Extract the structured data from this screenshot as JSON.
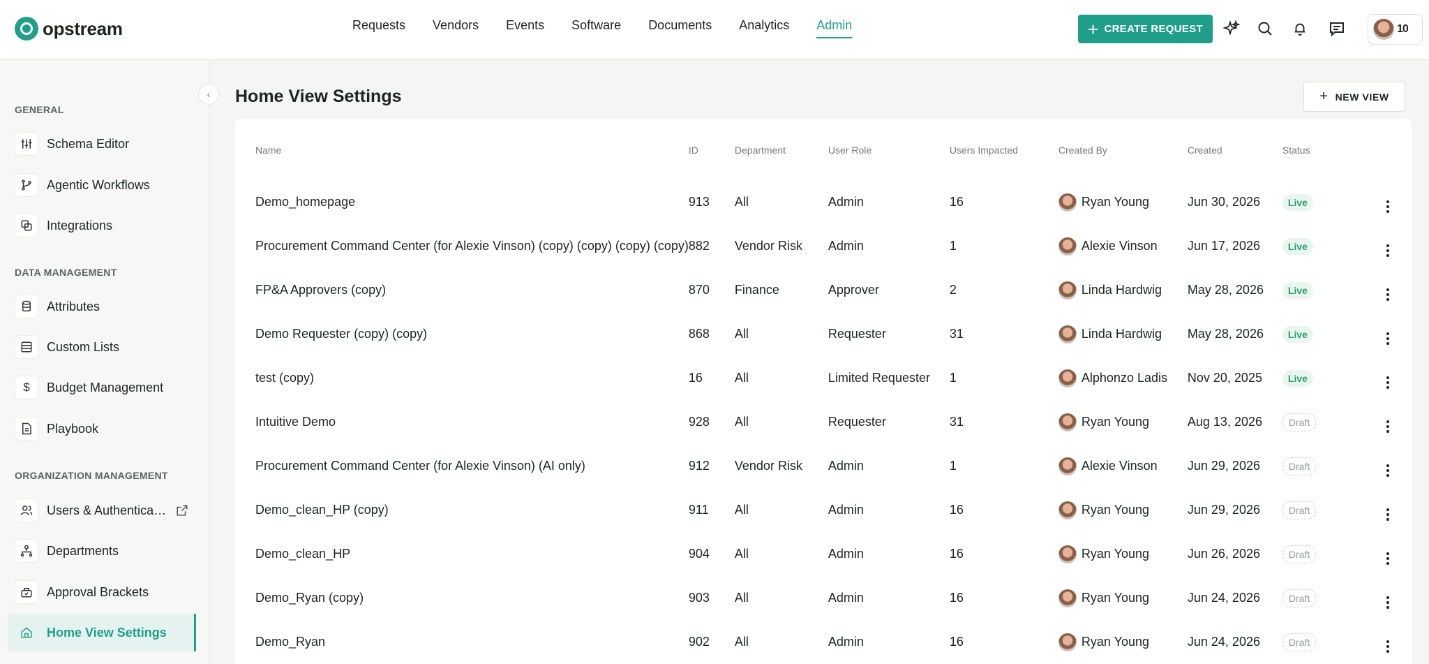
{
  "brand": {
    "name": "opstream",
    "accent": "#1f9f8a"
  },
  "nav": {
    "items": [
      "Requests",
      "Vendors",
      "Events",
      "Software",
      "Documents",
      "Analytics",
      "Admin"
    ],
    "active": "Admin",
    "create_label": "CREATE REQUEST",
    "icons": [
      "sparkle-icon",
      "search-icon",
      "bell-icon",
      "chat-icon"
    ],
    "user_initials": "10"
  },
  "sidebar": {
    "sections": [
      {
        "title": "GENERAL",
        "items": [
          {
            "label": "Schema Editor",
            "icon": "sliders-icon"
          },
          {
            "label": "Agentic Workflows",
            "icon": "branch-icon"
          },
          {
            "label": "Integrations",
            "icon": "integration-icon"
          }
        ]
      },
      {
        "title": "DATA MANAGEMENT",
        "items": [
          {
            "label": "Attributes",
            "icon": "database-icon"
          },
          {
            "label": "Custom Lists",
            "icon": "list-icon"
          },
          {
            "label": "Budget Management",
            "icon": "dollar-icon"
          },
          {
            "label": "Playbook",
            "icon": "document-icon"
          }
        ]
      },
      {
        "title": "ORGANIZATION MANAGEMENT",
        "items": [
          {
            "label": "Users & Authentications",
            "icon": "users-icon",
            "external": true
          },
          {
            "label": "Departments",
            "icon": "hierarchy-icon"
          },
          {
            "label": "Approval Brackets",
            "icon": "approval-icon"
          },
          {
            "label": "Home View Settings",
            "icon": "home-icon",
            "active": true
          }
        ]
      }
    ]
  },
  "main": {
    "title": "Home View Settings",
    "new_view_label": "NEW VIEW",
    "columns": [
      "Name",
      "ID",
      "Department",
      "User Role",
      "Users Impacted",
      "Created By",
      "Created",
      "Status"
    ],
    "rows": [
      {
        "name": "Demo_homepage",
        "id": "913",
        "department": "All",
        "role": "Admin",
        "users": "16",
        "created_by": "Ryan Young",
        "created": "Jun 30, 2026",
        "status": "Live"
      },
      {
        "name": "Procurement Command Center (for Alexie Vinson) (copy) (copy) (copy) (copy)",
        "id": "882",
        "department": "Vendor Risk",
        "role": "Admin",
        "users": "1",
        "created_by": "Alexie Vinson",
        "created": "Jun 17, 2026",
        "status": "Live"
      },
      {
        "name": "FP&A Approvers (copy)",
        "id": "870",
        "department": "Finance",
        "role": "Approver",
        "users": "2",
        "created_by": "Linda Hardwig",
        "created": "May 28, 2026",
        "status": "Live"
      },
      {
        "name": "Demo Requester (copy) (copy)",
        "id": "868",
        "department": "All",
        "role": "Requester",
        "users": "31",
        "created_by": "Linda Hardwig",
        "created": "May 28, 2026",
        "status": "Live"
      },
      {
        "name": "test (copy)",
        "id": "16",
        "department": "All",
        "role": "Limited Requester",
        "users": "1",
        "created_by": "Alphonzo Ladis",
        "created": "Nov 20, 2025",
        "status": "Live"
      },
      {
        "name": "Intuitive Demo",
        "id": "928",
        "department": "All",
        "role": "Requester",
        "users": "31",
        "created_by": "Ryan Young",
        "created": "Aug 13, 2026",
        "status": "Draft"
      },
      {
        "name": "Procurement Command Center (for Alexie Vinson) (AI only)",
        "id": "912",
        "department": "Vendor Risk",
        "role": "Admin",
        "users": "1",
        "created_by": "Alexie Vinson",
        "created": "Jun 29, 2026",
        "status": "Draft"
      },
      {
        "name": "Demo_clean_HP (copy)",
        "id": "911",
        "department": "All",
        "role": "Admin",
        "users": "16",
        "created_by": "Ryan Young",
        "created": "Jun 29, 2026",
        "status": "Draft"
      },
      {
        "name": "Demo_clean_HP",
        "id": "904",
        "department": "All",
        "role": "Admin",
        "users": "16",
        "created_by": "Ryan Young",
        "created": "Jun 26, 2026",
        "status": "Draft"
      },
      {
        "name": "Demo_Ryan (copy)",
        "id": "903",
        "department": "All",
        "role": "Admin",
        "users": "16",
        "created_by": "Ryan Young",
        "created": "Jun 24, 2026",
        "status": "Draft"
      },
      {
        "name": "Demo_Ryan",
        "id": "902",
        "department": "All",
        "role": "Admin",
        "users": "16",
        "created_by": "Ryan Young",
        "created": "Jun 24, 2026",
        "status": "Draft"
      }
    ]
  },
  "colors": {
    "live_text": "#2ca06c",
    "live_bg": "#e8f6ef",
    "draft_text": "#9a9d9b"
  }
}
